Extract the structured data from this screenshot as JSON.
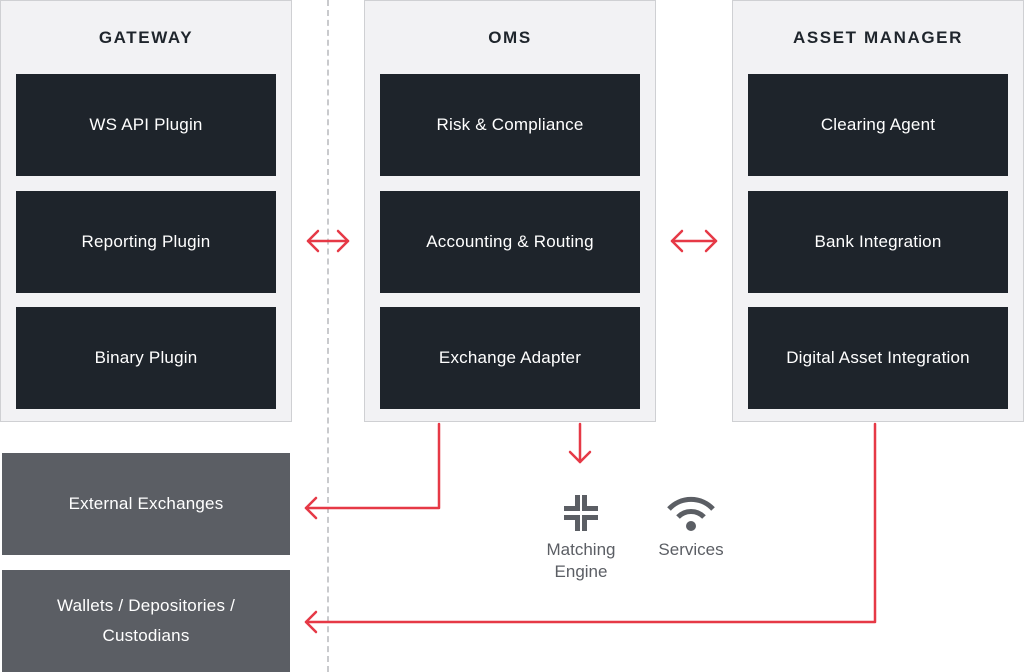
{
  "colors": {
    "panel_bg": "#f2f2f4",
    "module_bg": "#1e242b",
    "external_bg": "#5b5e64",
    "arrow": "#e63946",
    "icon": "#5b5e64"
  },
  "panels": [
    {
      "id": "gateway",
      "title": "GATEWAY",
      "modules": [
        "WS API Plugin",
        "Reporting Plugin",
        "Binary Plugin"
      ]
    },
    {
      "id": "oms",
      "title": "OMS",
      "modules": [
        "Risk & Compliance",
        "Accounting & Routing",
        "Exchange Adapter"
      ]
    },
    {
      "id": "asset-manager",
      "title": "ASSET MANAGER",
      "modules": [
        "Clearing Agent",
        "Bank Integration",
        "Digital Asset Integration"
      ]
    }
  ],
  "external": [
    {
      "id": "external-exchanges",
      "label_line1": "External Exchanges",
      "label_line2": ""
    },
    {
      "id": "wallets",
      "label_line1": "Wallets / Depositories /",
      "label_line2": "Custodians"
    }
  ],
  "services": [
    {
      "id": "matching-engine",
      "icon": "compress-arrows-icon",
      "label_line1": "Matching",
      "label_line2": "Engine"
    },
    {
      "id": "services",
      "icon": "wifi-icon",
      "label_line1": "Services",
      "label_line2": ""
    }
  ],
  "connections": [
    {
      "from": "gateway",
      "to": "oms",
      "type": "bidirectional"
    },
    {
      "from": "oms",
      "to": "asset-manager",
      "type": "bidirectional"
    },
    {
      "from": "oms",
      "to": "external-exchanges",
      "type": "directed"
    },
    {
      "from": "oms",
      "to": "matching-engine",
      "type": "directed"
    },
    {
      "from": "asset-manager",
      "to": "wallets",
      "type": "directed"
    }
  ]
}
